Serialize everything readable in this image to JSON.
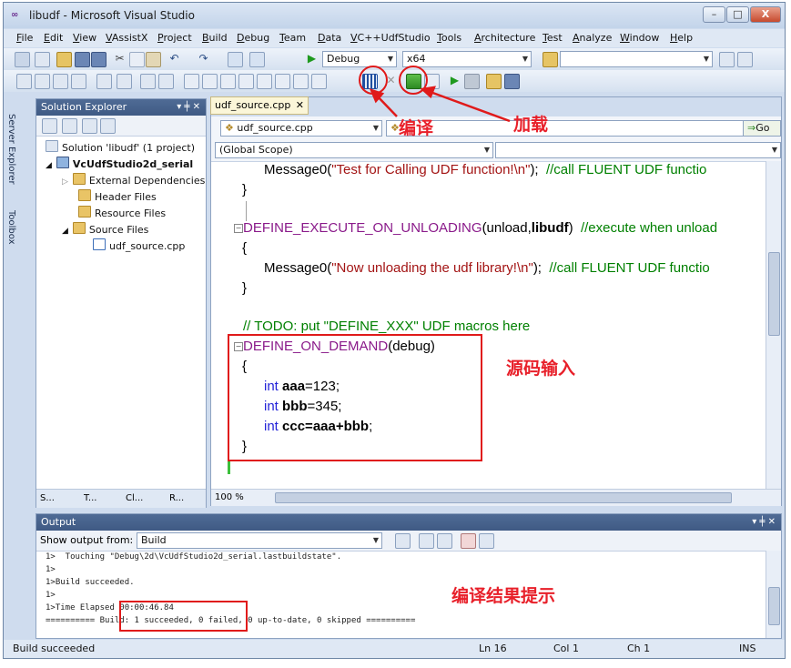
{
  "window": {
    "title": "libudf - Microsoft Visual Studio",
    "min": "–",
    "max": "□",
    "close": "X"
  },
  "menu": [
    "File",
    "Edit",
    "View",
    "VAssistX",
    "Project",
    "Build",
    "Debug",
    "Team",
    "Data",
    "VC++UdfStudio",
    "Tools",
    "Architecture",
    "Test",
    "Analyze",
    "Window",
    "Help"
  ],
  "toolbar": {
    "config": "Debug",
    "platform": "x64"
  },
  "side_tabs": {
    "server_explorer": "Server Explorer",
    "toolbox": "Toolbox"
  },
  "solution_explorer": {
    "title": "Solution Explorer",
    "pin": "▾ ╪ ✕",
    "items": [
      {
        "label": "Solution 'libudf' (1 project)"
      },
      {
        "label": "VcUdfStudio2d_serial"
      },
      {
        "label": "External Dependencies"
      },
      {
        "label": "Header Files"
      },
      {
        "label": "Resource Files"
      },
      {
        "label": "Source Files"
      },
      {
        "label": "udf_source.cpp"
      }
    ],
    "bottom_tabs": [
      "S...",
      "T...",
      "Cl...",
      "R..."
    ]
  },
  "editor": {
    "tab": "udf_source.cpp",
    "tab_close": "✕",
    "file_combo": "udf_source.cpp",
    "scope_combo": "(Global Scope)",
    "go_button": "Go",
    "zoom": "100 %",
    "lines": {
      "l1_func": "Message0(",
      "l1_str": "\"Test for Calling UDF function!\\n\"",
      "l1_end": ");  ",
      "l1_cmt": "//call FLUENT UDF functio",
      "l2": "}",
      "l3_macro": "DEFINE_EXECUTE_ON_UNLOADING",
      "l3_args1": "(unload,",
      "l3_bold": "libudf",
      "l3_args2": ")  ",
      "l3_cmt": "//execute when unload",
      "l4": "{",
      "l5_func": "Message0(",
      "l5_str": "\"Now unloading the udf library!\\n\"",
      "l5_end": ");  ",
      "l5_cmt": "//call FLUENT UDF functio",
      "l6": "}",
      "l7_cmt": "// TODO: put \"DEFINE_XXX\" UDF macros here",
      "l8_macro": "DEFINE_ON_DEMAND",
      "l8_args": "(debug)",
      "l9": "{",
      "l10_kw": "int ",
      "l10_rest": "aaa",
      "l10_val": "=123;",
      "l11_kw": "int ",
      "l11_rest": "bbb",
      "l11_val": "=345;",
      "l12_kw": "int ",
      "l12_a": "ccc",
      "l12_b": "=",
      "l12_c": "aaa",
      "l12_d": "+",
      "l12_e": "bbb",
      "l12_f": ";",
      "l13": "}"
    }
  },
  "output": {
    "title": "Output",
    "show_from_label": "Show output from:",
    "show_from_value": "Build",
    "lines": [
      "1>  Touching \"Debug\\2d\\VcUdfStudio2d_serial.lastbuildstate\".",
      "1>",
      "1>Build succeeded.",
      "1>",
      "1>Time Elapsed 00:00:46.84",
      "========== Build: 1 succeeded, 0 failed, 0 up-to-date, 0 skipped =========="
    ]
  },
  "status": {
    "text": "Build succeeded",
    "ln": "Ln 16",
    "col": "Col 1",
    "ch": "Ch 1",
    "ins": "INS"
  },
  "annotations": {
    "compile": "编译",
    "load": "加载",
    "source_input": "源码输入",
    "result_hint": "编译结果提示"
  },
  "colors": {
    "annotation_red": "#e01a1a",
    "macro": "#8a1a8a",
    "keyword": "#2323d8",
    "comment": "#008000",
    "string": "#a31515"
  }
}
